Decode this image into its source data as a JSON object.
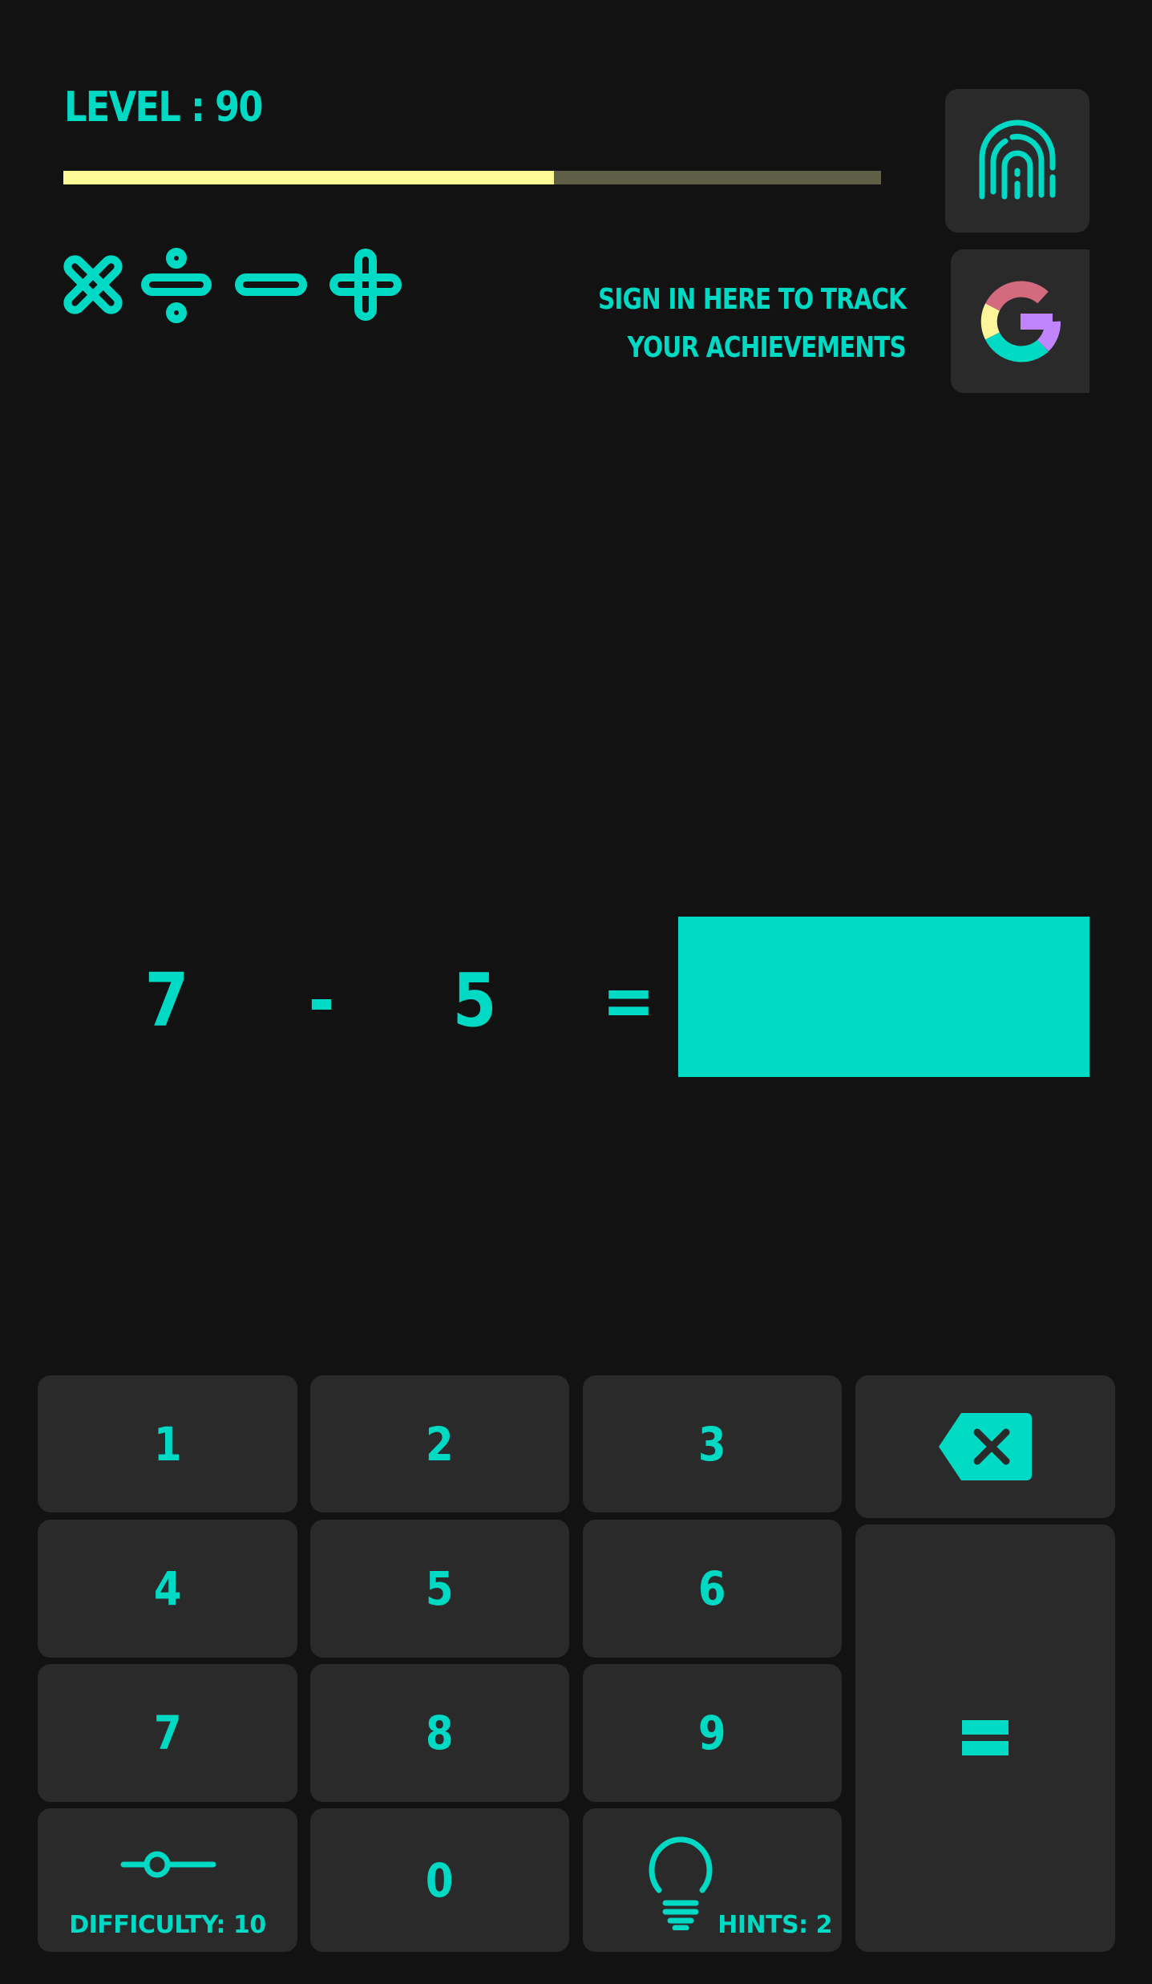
{
  "header": {
    "level_label": "LEVEL : 90",
    "level": 90,
    "progress_fraction": 0.6,
    "signin_line1": "SIGN IN HERE TO TRACK",
    "signin_line2": "YOUR ACHIEVEMENTS",
    "fingerprint_icon": "fingerprint-icon",
    "google_icon": "google-g-icon"
  },
  "operators": [
    {
      "name": "multiply-icon",
      "symbol": "×"
    },
    {
      "name": "divide-icon",
      "symbol": "÷"
    },
    {
      "name": "minus-icon",
      "symbol": "−"
    },
    {
      "name": "plus-icon",
      "symbol": "+"
    }
  ],
  "equation": {
    "operand1": "7",
    "operator": "-",
    "operand2": "5",
    "equals": "=",
    "answer": ""
  },
  "keypad": {
    "keys": [
      "1",
      "2",
      "3",
      "4",
      "5",
      "6",
      "7",
      "8",
      "9",
      "0"
    ],
    "backspace_icon": "backspace-icon",
    "equals_label": "=",
    "difficulty_label": "DIFFICULTY: 10",
    "difficulty_value": 10,
    "hints_label": "HINTS: 2",
    "hints_count": 2
  },
  "colors": {
    "background": "#121212",
    "key_background": "#2a2a2a",
    "accent": "#00d9c4",
    "progress_fill": "#fdfb95",
    "progress_track": "#5f5f48",
    "google_red": "#d46a7e",
    "google_yellow": "#fdf59a",
    "google_teal": "#00d9c4",
    "google_purple": "#c084fc"
  }
}
